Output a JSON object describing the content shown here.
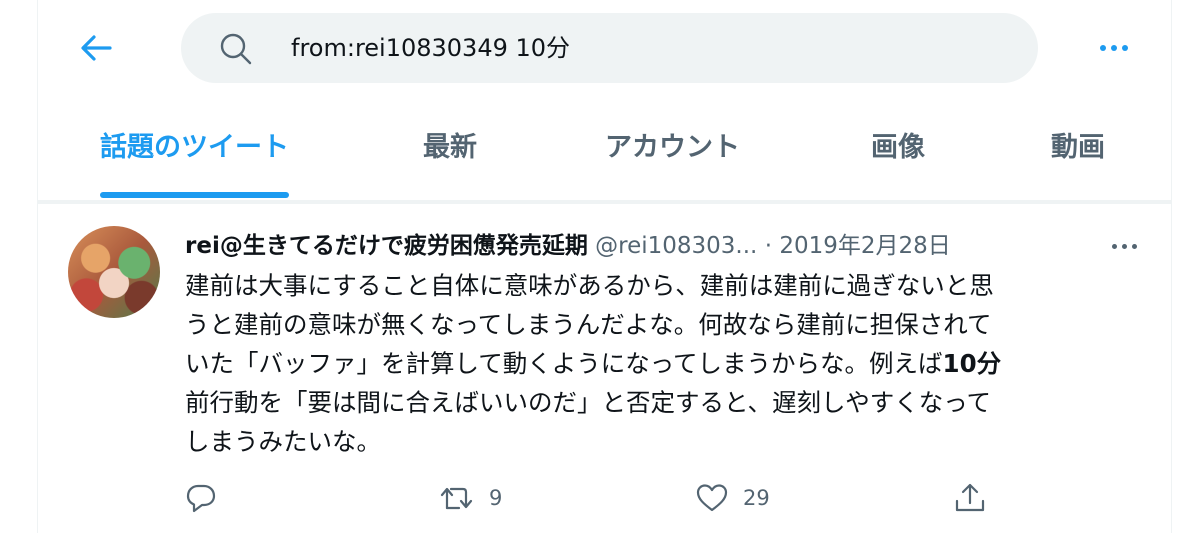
{
  "search": {
    "query": "from:rei10830349 10分"
  },
  "tabs": [
    {
      "label": "話題のツイート",
      "active": true
    },
    {
      "label": "最新",
      "active": false
    },
    {
      "label": "アカウント",
      "active": false
    },
    {
      "label": "画像",
      "active": false
    },
    {
      "label": "動画",
      "active": false
    }
  ],
  "tweet": {
    "name": "rei@生きてるだけで疲労困憊発売延期",
    "handle": "@rei108303...",
    "separator": "·",
    "date": "2019年2月28日",
    "text_line1": "建前は大事にすること自体に意味があるから、建前は建前に過ぎないと思",
    "text_line2": "うと建前の意味が無くなってしまうんだよな。何故なら建前に担保されて",
    "text_line3_before": "いた「バッファ」を計算して動くようになってしまうからな。例えば",
    "text_line3_bold": "10分",
    "text_line4": "前行動を「要は間に合えばいいのだ」と否定すると、遅刻しやすくなって",
    "text_line5": "しまうみたいな。",
    "reply_count": "",
    "retweet_count": "9",
    "like_count": "29"
  },
  "icons": {
    "back": "arrow-left-icon",
    "search": "search-icon",
    "more": "more-dots-icon",
    "reply": "reply-icon",
    "retweet": "retweet-icon",
    "like": "heart-icon",
    "share": "share-icon"
  },
  "colors": {
    "accent": "#1d9bf0",
    "secondary_text": "#536471",
    "search_bg": "#eff3f4"
  }
}
